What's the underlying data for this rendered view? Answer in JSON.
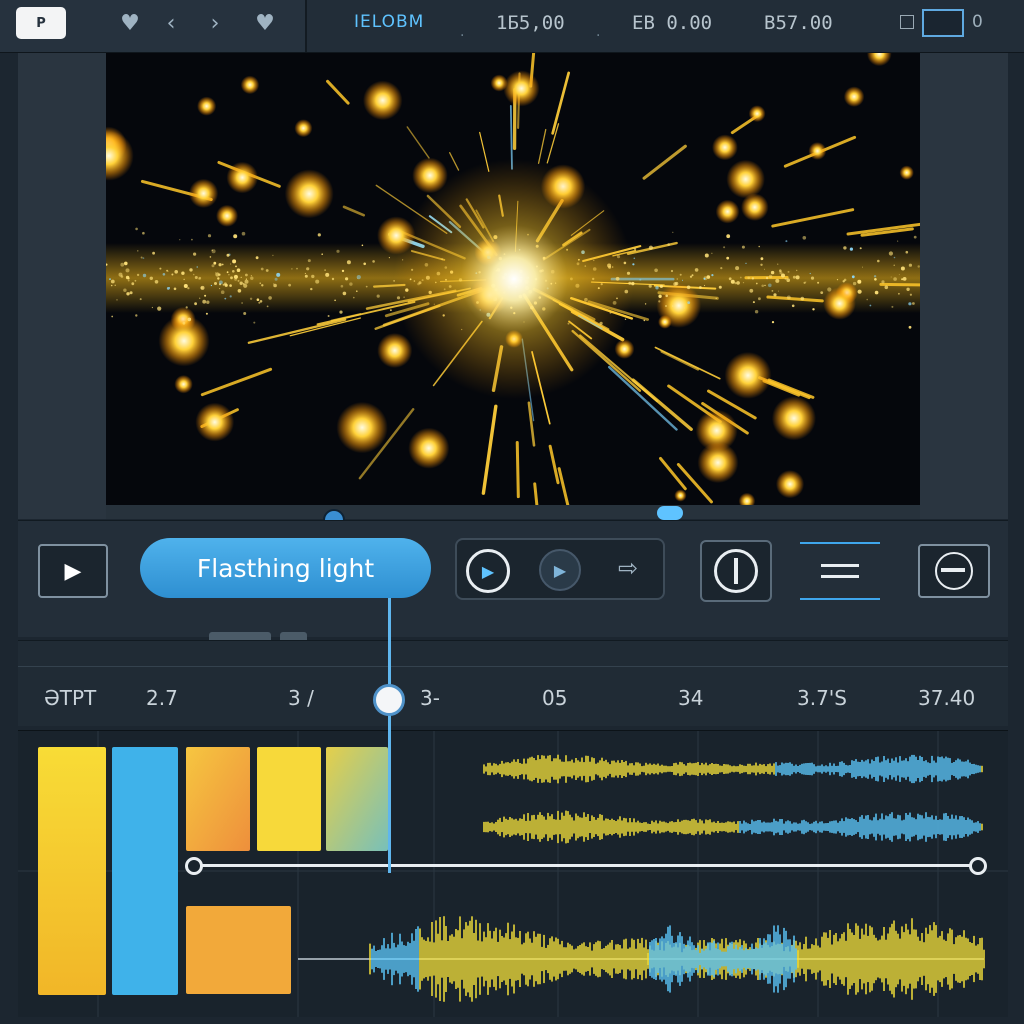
{
  "topbar": {
    "logo_label": "P",
    "project_name": "IELOBM",
    "readouts": [
      "1Б5,00",
      "EB 0.00",
      "B57.00"
    ],
    "zoom_value": "0"
  },
  "preview": {
    "subject": "golden starburst particles"
  },
  "controls": {
    "clip_title": "Flasthing light"
  },
  "ruler": {
    "ticks": [
      "ƏTPT",
      "2.7",
      "3 /",
      "3-",
      "05",
      "34",
      "3.7'S",
      "37.40"
    ]
  },
  "timeline": {
    "clips": [
      {
        "track": "video",
        "color": "#f6d637"
      },
      {
        "track": "video",
        "color": "#3fb2ea"
      },
      {
        "track": "video",
        "color": "#f0a340"
      },
      {
        "track": "video",
        "color": "#f7d93a"
      },
      {
        "track": "video",
        "color": "#d1c95c"
      },
      {
        "track": "video",
        "color": "#f2a93a"
      }
    ],
    "waveform_colors": {
      "gold": "#f7e23a",
      "blue": "#5ecbff"
    }
  },
  "colors": {
    "accent": "#4fb2ec",
    "background": "#1c2630",
    "highlight": "#ffd23a"
  }
}
